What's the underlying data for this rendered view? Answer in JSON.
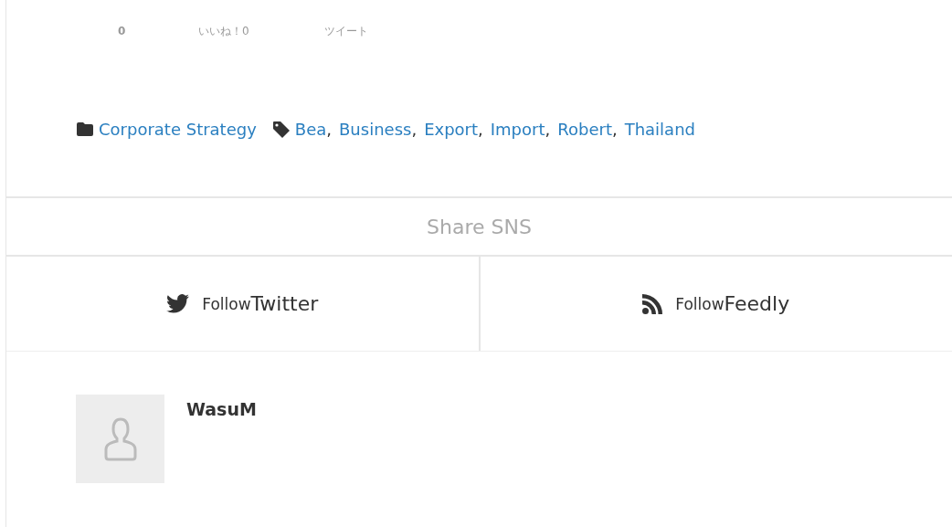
{
  "share_counts": [
    {
      "kind": "count",
      "text": "0"
    },
    {
      "kind": "like",
      "text": "いいね！0"
    },
    {
      "kind": "tweet",
      "text": "ツイート"
    }
  ],
  "category": "Corporate Strategy",
  "tags": {
    "separator": ",",
    "items": [
      "Bea",
      "Business",
      "Export",
      "Import",
      "Robert",
      "Thailand"
    ]
  },
  "share_heading": "Share SNS",
  "follow": [
    {
      "kind": "twitter",
      "prefix": "Follow",
      "label": "Twitter"
    },
    {
      "kind": "rss",
      "prefix": "Follow",
      "label": "Feedly"
    }
  ],
  "author": {
    "name": "WasuM"
  }
}
